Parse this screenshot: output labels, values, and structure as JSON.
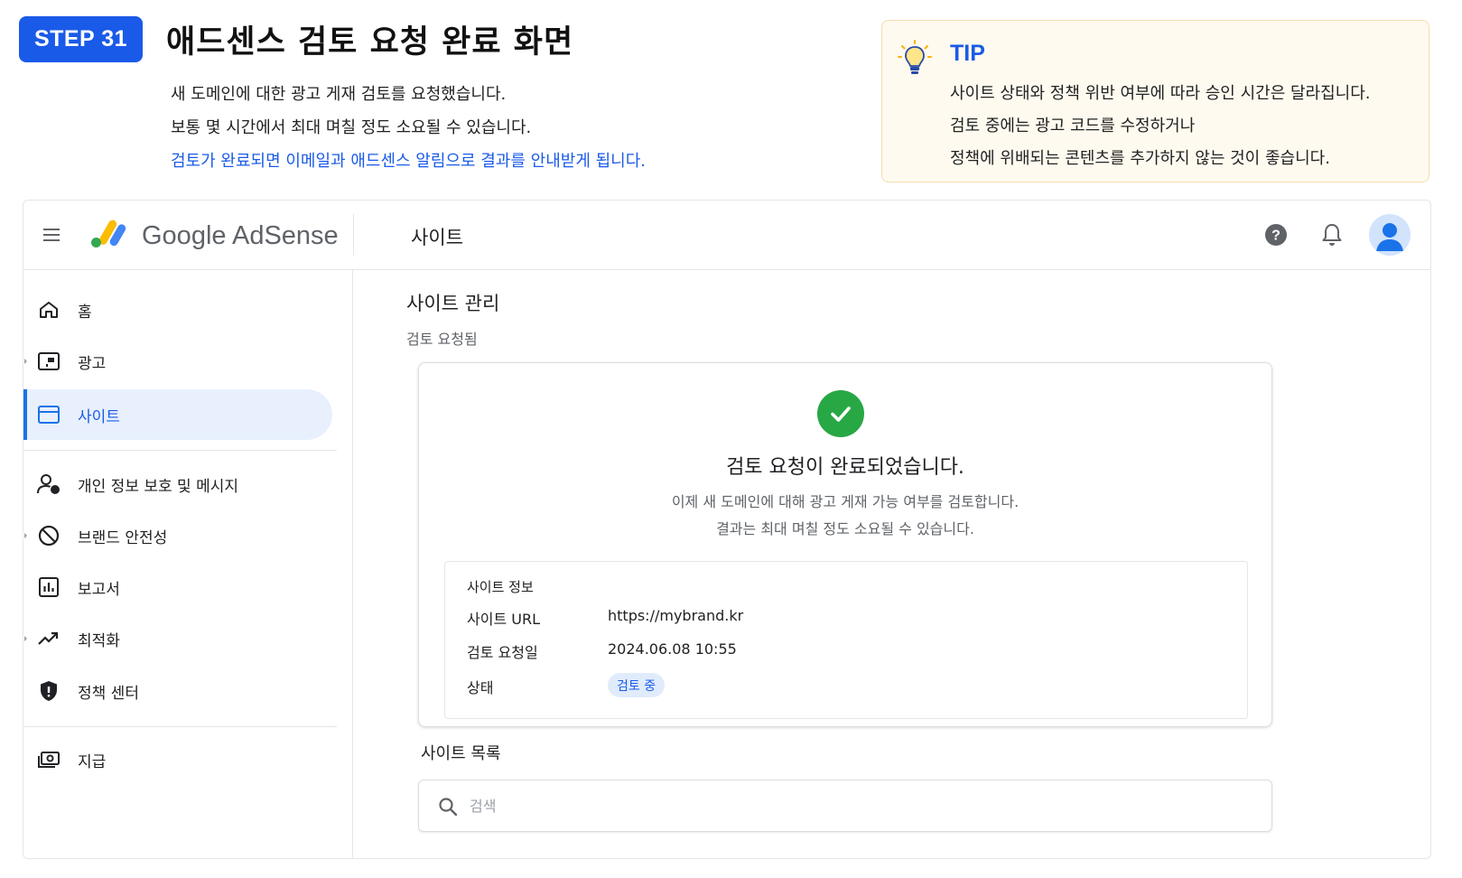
{
  "tutorial": {
    "step_label": "STEP 31",
    "title": "애드센스 검토 요청 완료 화면",
    "lines": [
      "새 도메인에 대한 광고 게재 검토를 요청했습니다.",
      "보통 몇 시간에서 최대 며칠 정도 소요될 수 있습니다.",
      "검토가 완료되면 이메일과 애드센스 알림으로 결과를 안내받게 됩니다."
    ],
    "highlight_color": "#1a5ae8"
  },
  "tip": {
    "title": "TIP",
    "icon": "lightbulb-icon",
    "lines": [
      "사이트 상태와 정책 위반 여부에 따라 승인 시간은 달라집니다.",
      "검토 중에는 광고 코드를 수정하거나",
      "정책에 위배되는 콘텐츠를 추가하지 않는 것이 좋습니다."
    ]
  },
  "app": {
    "logo_text": "Google AdSense",
    "page_heading": "사이트",
    "topbar_icons": [
      "help-icon",
      "bell-icon",
      "avatar"
    ],
    "sidebar": {
      "items": [
        {
          "label": "홈",
          "icon": "home-icon"
        },
        {
          "label": "광고",
          "icon": "ads-icon"
        },
        {
          "label": "사이트",
          "icon": "sites-icon",
          "active": true
        },
        {
          "label": "개인 정보 보호 및 메시지",
          "icon": "privacy-icon"
        },
        {
          "label": "브랜드 안전성",
          "icon": "block-icon"
        },
        {
          "label": "보고서",
          "icon": "reports-icon"
        },
        {
          "label": "최적화",
          "icon": "trending-icon"
        },
        {
          "label": "정책 센터",
          "icon": "shield-icon"
        },
        {
          "label": "지급",
          "icon": "payments-icon"
        }
      ]
    },
    "main": {
      "title": "사이트 관리",
      "subtitle": "검토 요청됨",
      "card": {
        "title": "검토 요청이 완료되었습니다.",
        "lines": [
          "이제 새 도메인에 대해 광고 게재 가능 여부를 검토합니다.",
          "결과는 최대 며칠 정도 소요될 수 있습니다."
        ],
        "info": {
          "heading": "사이트 정보",
          "url_label": "사이트 URL",
          "url_value": "https://mybrand.kr",
          "date_label": "검토 요청일",
          "date_value": "2024.06.08 10:55",
          "status_label": "상태",
          "status_value": "검토 중"
        }
      },
      "list_title": "사이트 목록",
      "search": {
        "placeholder": "검색",
        "value": ""
      }
    },
    "colors": {
      "accent": "#1a73e8",
      "success": "#28a745",
      "active_bg": "#e8f0fe"
    }
  }
}
